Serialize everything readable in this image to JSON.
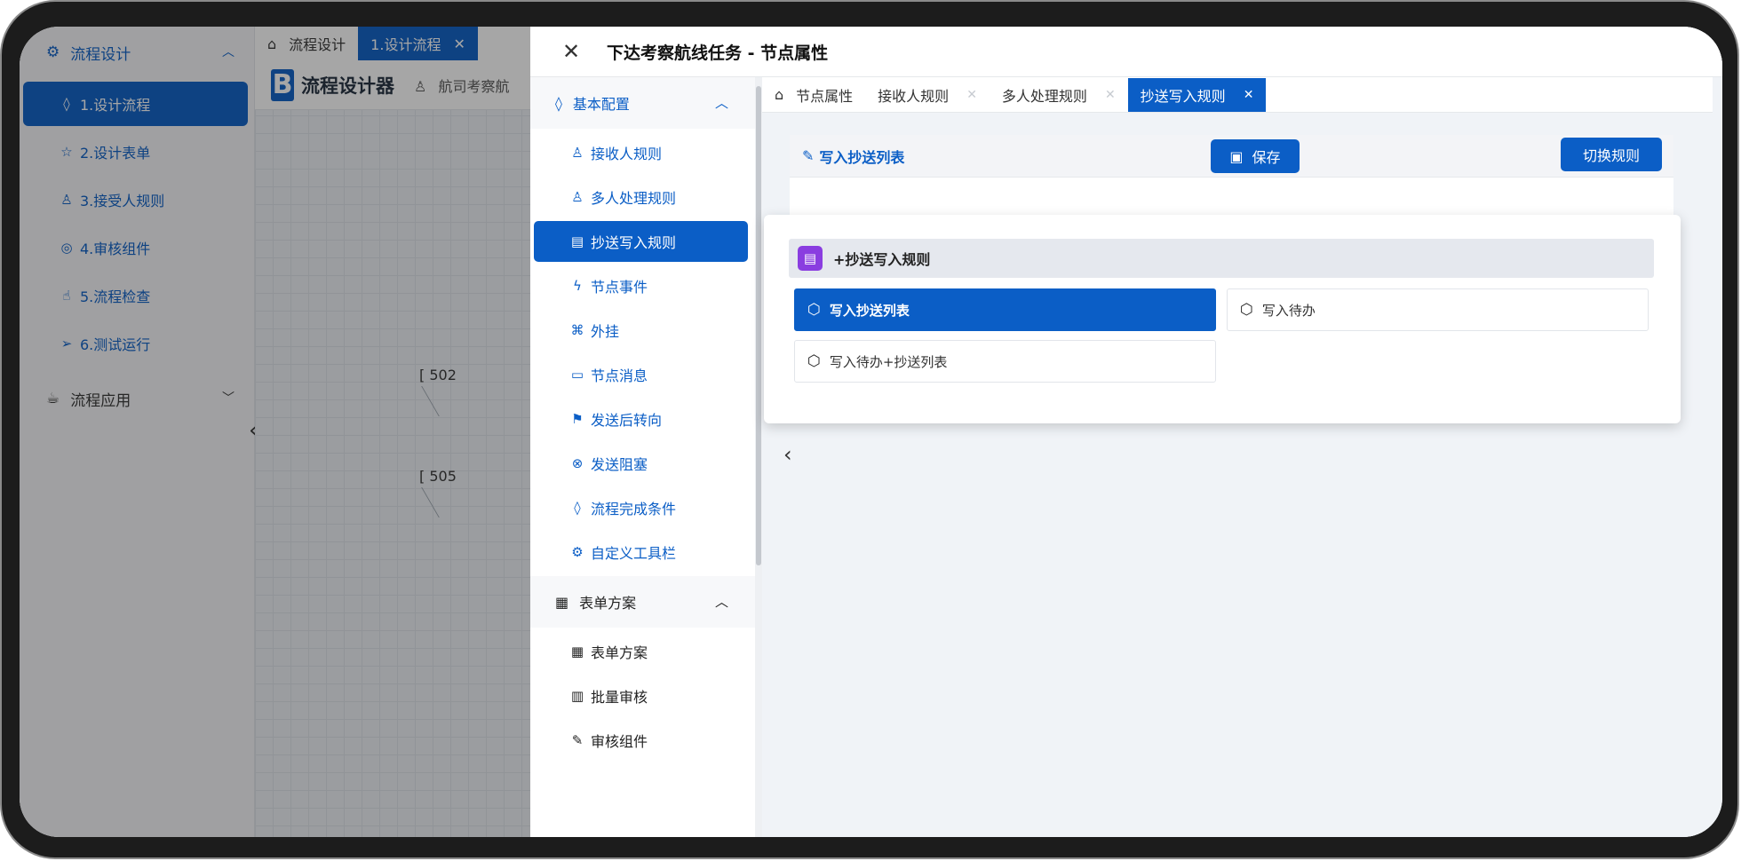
{
  "left_nav": {
    "group_title": "流程设计",
    "items": [
      {
        "icon": "droplet-icon",
        "label": "1.设计流程"
      },
      {
        "icon": "star-icon",
        "label": "2.设计表单"
      },
      {
        "icon": "user-icon",
        "label": "3.接受人规则"
      },
      {
        "icon": "check-circle-icon",
        "label": "4.审核组件"
      },
      {
        "icon": "thumb-icon",
        "label": "5.流程检查"
      },
      {
        "icon": "send-icon",
        "label": "6.测试运行"
      }
    ],
    "group2_title": "流程应用"
  },
  "designer": {
    "tab_home": "流程设计",
    "tab_active": "1.设计流程",
    "title": "流程设计器",
    "subtitle": "航司考察航",
    "node1": "[ 502",
    "node2": "[ 505"
  },
  "drawer": {
    "title": "下达考察航线任务 - 节点属性",
    "side_group1": "基本配置",
    "side_items": [
      {
        "icon": "user-icon",
        "label": "接收人规则"
      },
      {
        "icon": "users-icon",
        "label": "多人处理规则"
      },
      {
        "icon": "book-icon",
        "label": "抄送写入规则"
      },
      {
        "icon": "bolt-icon",
        "label": "节点事件"
      },
      {
        "icon": "plugin-icon",
        "label": "外挂"
      },
      {
        "icon": "message-icon",
        "label": "节点消息"
      },
      {
        "icon": "signpost-icon",
        "label": "发送后转向"
      },
      {
        "icon": "x-circle-icon",
        "label": "发送阻塞"
      },
      {
        "icon": "droplet-icon",
        "label": "流程完成条件"
      },
      {
        "icon": "gear-icon",
        "label": "自定义工具栏"
      }
    ],
    "side_group2": "表单方案",
    "side_items2": [
      {
        "icon": "grid-icon",
        "label": "表单方案"
      },
      {
        "icon": "batch-icon",
        "label": "批量审核"
      },
      {
        "icon": "edit-icon",
        "label": "审核组件"
      }
    ],
    "tabs": [
      "节点属性",
      "接收人规则",
      "多人处理规则",
      "抄送写入规则"
    ],
    "card_title": "写入抄送列表",
    "save_label": "保存",
    "switch_label": "切换规则",
    "popup": {
      "title": "+抄送写入规则",
      "options": [
        "写入抄送列表",
        "写入待办",
        "写入待办+抄送列表"
      ],
      "selected": "写入抄送列表"
    }
  },
  "colors": {
    "accent": "#0b5ec6",
    "doc_icon": "#8a3de0"
  }
}
